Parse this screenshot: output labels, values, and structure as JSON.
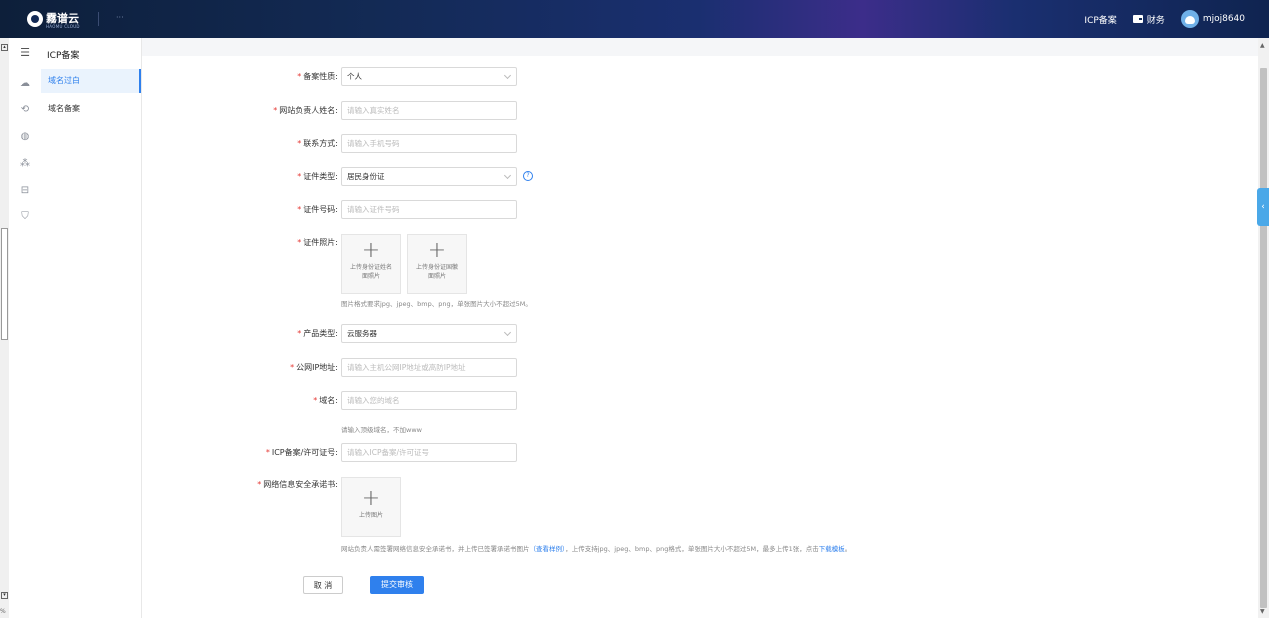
{
  "header": {
    "brand": "霧谱云",
    "brand_sub": "HAOMU CLOUD",
    "dots": "···",
    "icp_link": "ICP备案",
    "finance_label": "财务",
    "username": "mjoj8640"
  },
  "outer": {
    "percent": "%"
  },
  "sidebar": {
    "title": "ICP备案",
    "items": [
      {
        "label": "域名过白",
        "active": true
      },
      {
        "label": "域名备案",
        "active": false
      }
    ],
    "icons": [
      "list-icon",
      "cloud-icon",
      "refresh-icon",
      "globe-icon",
      "network-icon",
      "storage-icon",
      "shield-icon"
    ]
  },
  "form": {
    "fields": [
      {
        "label": "备案性质:",
        "value": "个人",
        "type": "select"
      },
      {
        "label": "网站负责人姓名:",
        "placeholder": "请输入真实姓名",
        "type": "input"
      },
      {
        "label": "联系方式:",
        "placeholder": "请输入手机号码",
        "type": "input"
      },
      {
        "label": "证件类型:",
        "value": "居民身份证",
        "type": "select"
      },
      {
        "label": "证件号码:",
        "placeholder": "请输入证件号码",
        "type": "input"
      },
      {
        "label": "证件照片:",
        "type": "upload"
      },
      {
        "label": "产品类型:",
        "value": "云服务器",
        "type": "select"
      },
      {
        "label": "公网IP地址:",
        "placeholder": "请输入主机公网IP地址或高防IP地址",
        "type": "input"
      },
      {
        "label": "域名:",
        "placeholder": "请输入您的域名",
        "type": "input"
      },
      {
        "label": "ICP备案/许可证号:",
        "placeholder": "请输入ICP备案/许可证号",
        "type": "input"
      },
      {
        "label": "网络信息安全承诺书:",
        "type": "upload"
      }
    ],
    "id_upload_front": [
      "上传身份证姓名",
      "面照片"
    ],
    "id_upload_back": [
      "上传身份证国徽",
      "面照片"
    ],
    "upload_plus": "+",
    "id_photo_hint": "图片格式要求jpg、jpeg、bmp、png，单张图片大小不超过5M。",
    "domain_hint": "请输入顶级域名，不加www",
    "commit_upload": "上传图片",
    "commit_hint_pre": "网站负责人需签署网络信息安全承诺书，并上传已签署承诺书图片",
    "commit_hint_link1": "（查看样例）",
    "commit_hint_mid": "，上传支持jpg、jpeg、bmp、png格式，单张图片大小不超过5M，最多上传1张，点击",
    "commit_hint_link2": "下载模板",
    "commit_hint_end": "。",
    "help_glyph": "?",
    "cancel": "取 消",
    "submit": "提交审核"
  },
  "colors": {
    "accent": "#2f80ed",
    "required": "#e53935",
    "topbar": "#132a55"
  }
}
